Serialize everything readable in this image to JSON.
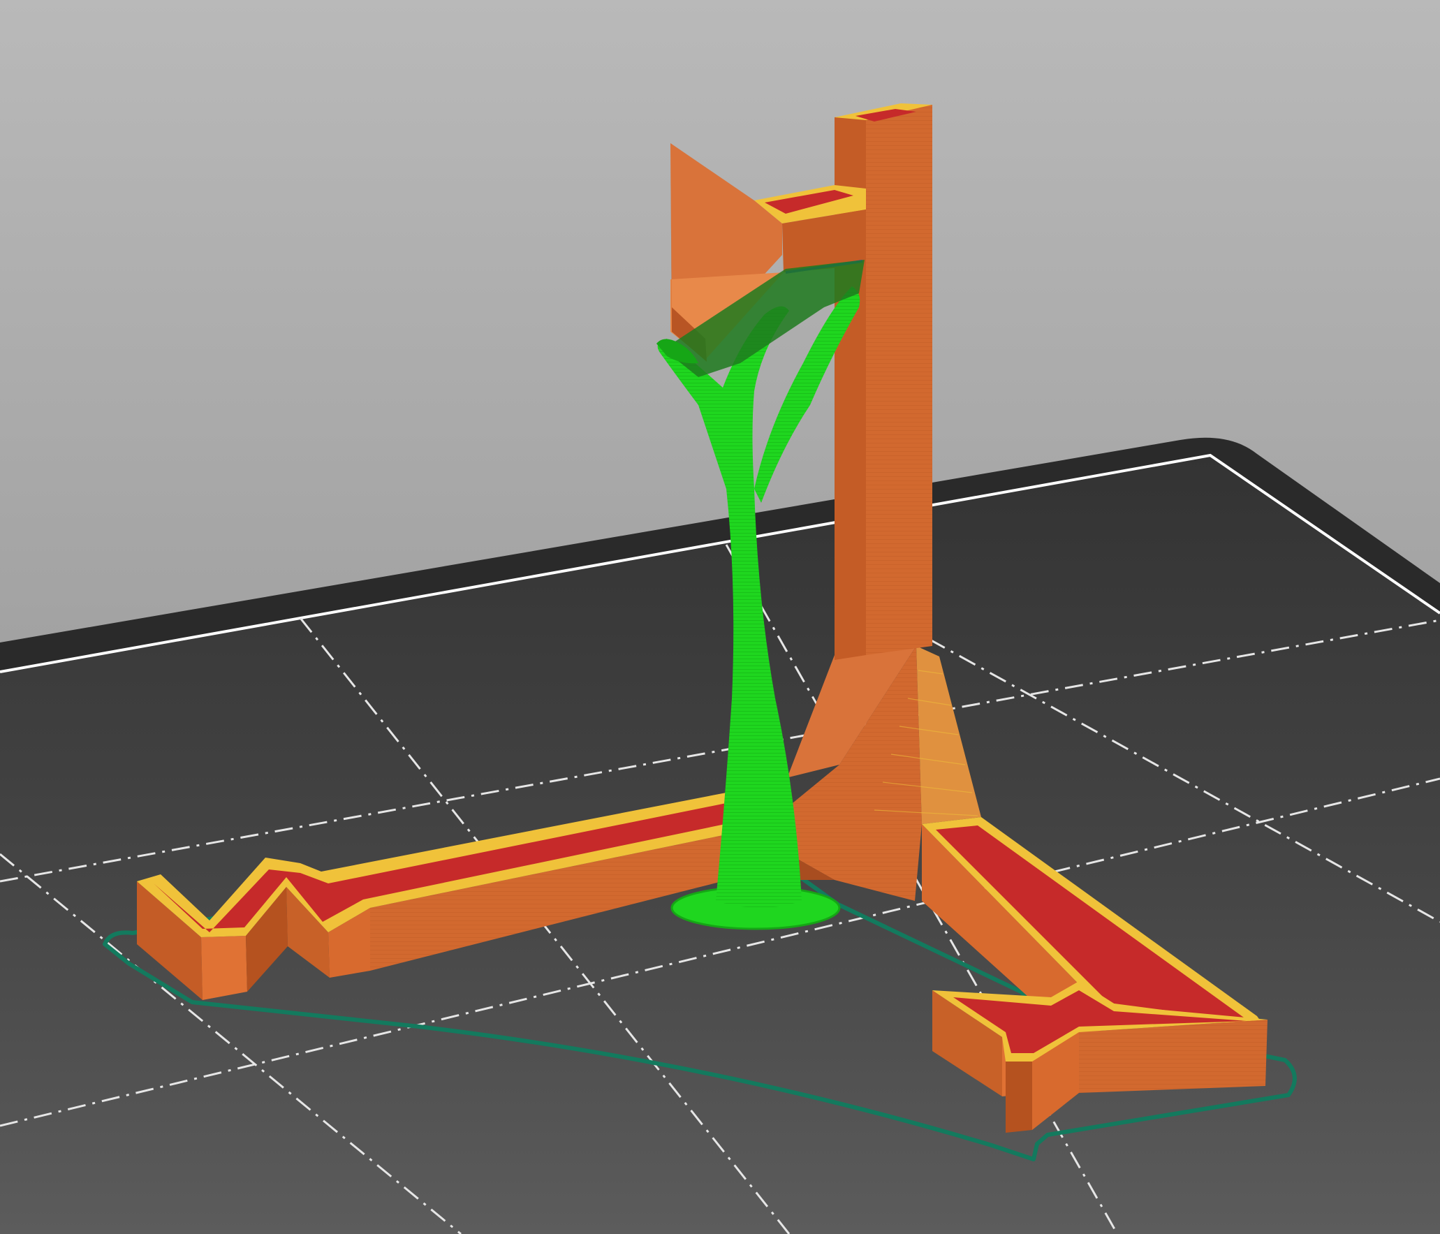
{
  "app": {
    "view": "slicer-preview-3d"
  },
  "colors": {
    "background_top": "#b7b7b7",
    "background_bottom": "#8e8e8e",
    "bed_surface": "#3a3a3a",
    "bed_surface_light": "#555555",
    "bed_border": "#2b2b2b",
    "bed_outline": "#ffffff",
    "grid_line": "#e8e8e8",
    "perimeter_orange": "#d2692f",
    "perimeter_orange_shade": "#b85524",
    "perimeter_orange_dark": "#a84d20",
    "solid_infill_red": "#c62a2a",
    "top_perimeter_yellow": "#f0c23a",
    "support_green": "#1fd61f",
    "support_green_dark": "#16a616",
    "support_interface_dark": "#1e7a1e",
    "skirt_teal": "#137a5e",
    "bridge_blue": "#2a3fd0"
  },
  "scene": {
    "objects": [
      {
        "name": "part",
        "feature": "perimeter"
      },
      {
        "name": "tree-support",
        "feature": "support-material"
      },
      {
        "name": "skirt",
        "feature": "skirt"
      }
    ]
  }
}
